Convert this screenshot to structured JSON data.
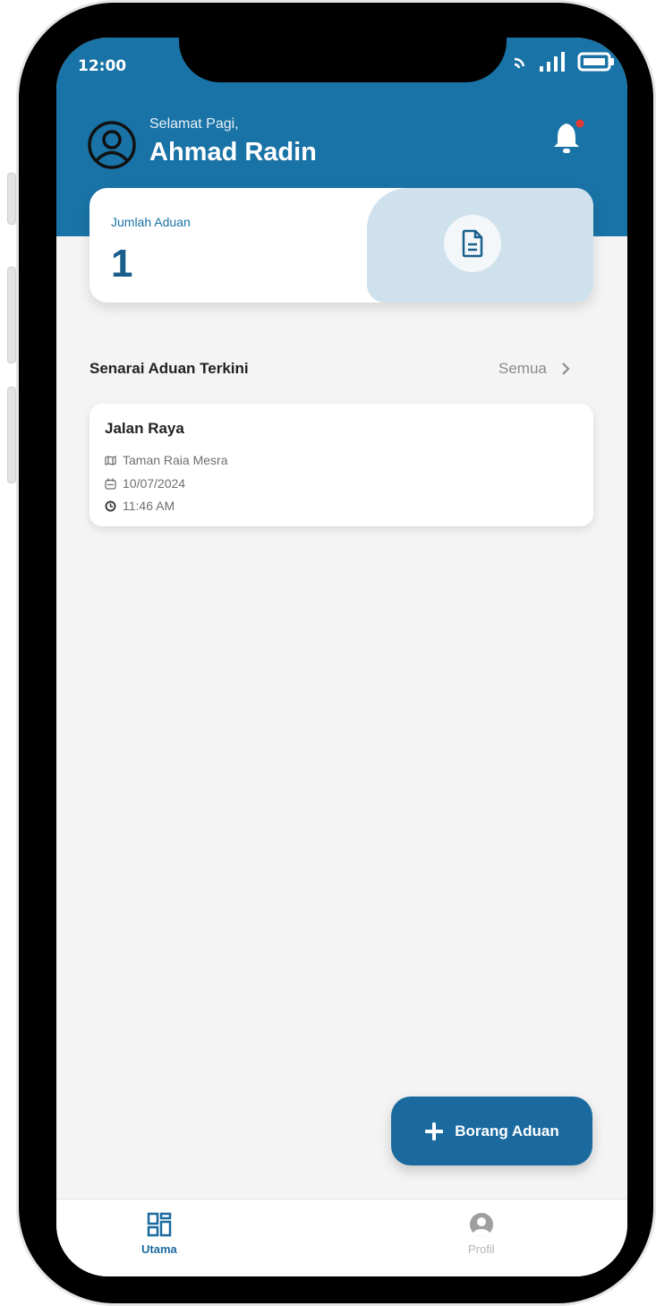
{
  "status_bar": {
    "time": "12:00"
  },
  "header": {
    "greeting": "Selamat Pagi,",
    "username": "Ahmad Radin"
  },
  "summary": {
    "label": "Jumlah Aduan",
    "count": "1"
  },
  "recent": {
    "title": "Senarai Aduan Terkini",
    "see_all": "Semua",
    "items": [
      {
        "title": "Jalan Raya",
        "location": "Taman Raia Mesra",
        "date": "10/07/2024",
        "time": "11:46 AM"
      }
    ]
  },
  "fab": {
    "label": "Borang Aduan"
  },
  "bottom_nav": {
    "items": [
      {
        "label": "Utama",
        "icon": "dashboard-icon",
        "active": true
      },
      {
        "label": "Profil",
        "icon": "profile-icon",
        "active": false
      }
    ]
  },
  "colors": {
    "primary": "#1a73a6",
    "primary_dark": "#1a6aa0",
    "accent_light": "#cfe1ec",
    "notification_dot": "#e53935",
    "background": "#f4f4f4"
  }
}
